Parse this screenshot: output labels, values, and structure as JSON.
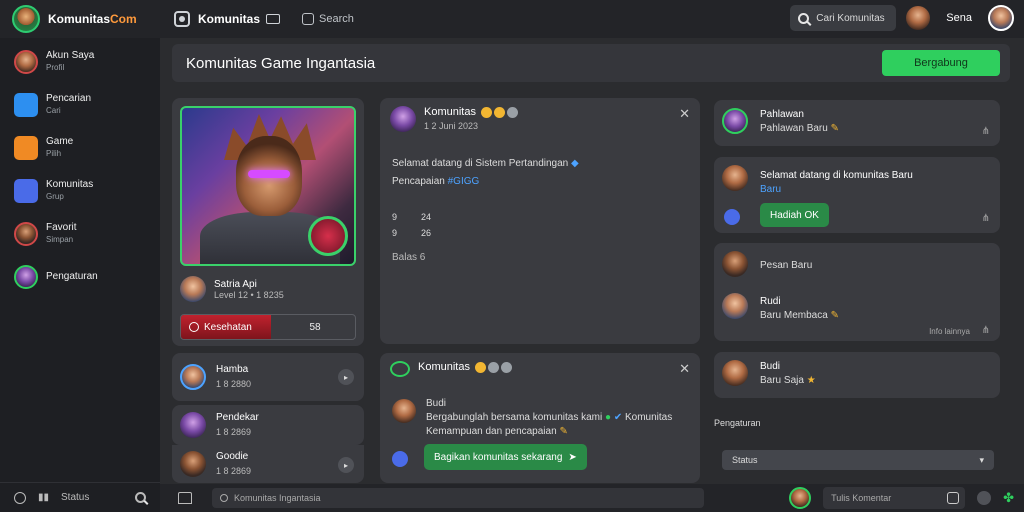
{
  "header": {
    "brand_name": "Komunitas",
    "brand_suffix": "Com",
    "title": "Komunitas",
    "search_link": "Search",
    "search_placeholder": "Cari Komunitas",
    "user_name": "Sena"
  },
  "sidebar": {
    "items": [
      {
        "label": "Akun Saya",
        "sub": "Profil",
        "icon": "avatar-icon"
      },
      {
        "label": "Pencarian",
        "sub": "Cari",
        "icon": "message-icon"
      },
      {
        "label": "Game",
        "sub": "Pilih",
        "icon": "gamepad-icon"
      },
      {
        "label": "Komunitas",
        "sub": "Grup",
        "icon": "discord-icon"
      },
      {
        "label": "Favorit",
        "sub": "Simpan",
        "icon": "avatar-icon"
      },
      {
        "label": "Pengaturan",
        "sub": "",
        "icon": "avatar-icon"
      }
    ],
    "bottom_label": "Status"
  },
  "banner": {
    "title": "Komunitas Game Ingantasia",
    "join_label": "Bergabung"
  },
  "character": {
    "name": "Satria Api",
    "meta": "Level 12 • 1 8235",
    "hp_label": "Kesehatan",
    "hp_value": "58",
    "hp_fraction": 0.52
  },
  "mini_cards": [
    {
      "name": "Hamba",
      "sub": "1 8 2880"
    },
    {
      "name": "Pendekar",
      "sub": "1 8 2869"
    },
    {
      "name": "Goodie",
      "sub": "1 8 2869"
    }
  ],
  "post1": {
    "name": "Komunitas",
    "sub": "1 2 Juni 2023",
    "line1": "Selamat datang di Sistem Pertandingan",
    "line2_a": "Pencapaian",
    "line2_b": "#GIGG",
    "stats": [
      {
        "a": "9",
        "b": "24"
      },
      {
        "a": "9",
        "b": "26"
      }
    ],
    "footer": "Balas 6"
  },
  "post2": {
    "name": "Komunitas",
    "author": "Budi",
    "body1": "Bergabunglah bersama komunitas kami",
    "body1_tail": "Komunitas",
    "body2": "Kemampuan dan pencapaian",
    "chip": "Bagikan komunitas sekarang"
  },
  "right": [
    {
      "name": "Pahlawan",
      "sub": "Pahlawan Baru"
    },
    {
      "name": "Selamat datang di komunitas Baru",
      "sub": "Baru",
      "chip": "Hadiah OK"
    },
    {
      "name": "",
      "sub": "Pesan Baru"
    },
    {
      "name": "Rudi",
      "sub": "Baru Membaca",
      "meta": "Info lainnya"
    },
    {
      "name": "Budi",
      "sub": "Baru Saja"
    }
  ],
  "right_footer": {
    "label": "Pengaturan",
    "select": "Status"
  },
  "bottom": {
    "input_placeholder": "Komunitas Ingantasia",
    "compose": "Tulis Komentar"
  },
  "colors": {
    "accent_green": "#2fcf5e",
    "hp_red": "#c0222e",
    "link_blue": "#4da3ff"
  }
}
